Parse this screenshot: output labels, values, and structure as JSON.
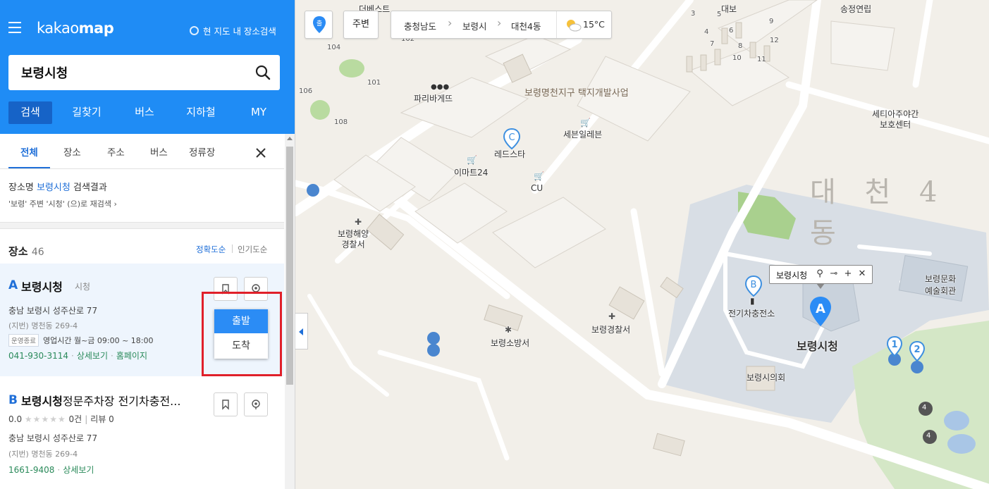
{
  "header": {
    "logo_light": "kakao",
    "logo_bold": "map",
    "area_search_label": "현 지도 내 장소검색",
    "search_value": "보령시청",
    "main_tabs": [
      {
        "label": "검색",
        "active": true
      },
      {
        "label": "길찾기",
        "active": false
      },
      {
        "label": "버스",
        "active": false
      },
      {
        "label": "지하철",
        "active": false
      },
      {
        "label": "MY",
        "active": false
      }
    ]
  },
  "sub_tabs": [
    {
      "label": "전체",
      "active": true
    },
    {
      "label": "장소",
      "active": false
    },
    {
      "label": "주소",
      "active": false
    },
    {
      "label": "버스",
      "active": false
    },
    {
      "label": "정류장",
      "active": false
    }
  ],
  "result": {
    "prefix": "장소명 ",
    "query": "보령시청",
    "suffix": " 검색결과",
    "research_text": "'보령' 주변 '시청' (으)로 재검색 ›"
  },
  "places": {
    "heading": "장소",
    "count": "46",
    "sort_accuracy": "정확도순",
    "sort_popularity": "인기도순"
  },
  "items": [
    {
      "marker": "A",
      "title_bold": "보령시청",
      "title_rest": "",
      "category": "시청",
      "address": "충남 보령시 성주산로 77",
      "lot_address": "(지번) 명천동 269-4",
      "hours_tag": "운영종료",
      "hours": "영업시간 월~금 09:00 ~ 18:00",
      "phone": "041-930-3114",
      "detail_link": "상세보기",
      "homepage_link": "홈페이지"
    },
    {
      "marker": "B",
      "title_bold": "보령시청",
      "title_rest": "정문주차장 전기차충전...",
      "rating": "0.0",
      "stars": "★★★★★",
      "rating_count": "0건",
      "review": "리뷰 0",
      "address": "충남 보령시 성주산로 77",
      "lot_address": "(지번) 명천동 269-4",
      "phone": "1661-9408",
      "detail_link": "상세보기"
    }
  ],
  "route_popup": {
    "departure": "출발",
    "arrival": "도착"
  },
  "map": {
    "my_location_label": "출",
    "nearby_label": "주변",
    "breadcrumb": [
      "충청남도",
      "보령시",
      "대천4동"
    ],
    "weather": "15°C",
    "dong_label": "대 천 4 동",
    "redevelopment_label": "보령명천지구 택지개발사업",
    "labels": {
      "paris": "파리바게뜨",
      "seven": "세븐일레븐",
      "redstar": "레드스타",
      "emart": "이마트24",
      "cu": "CU",
      "police_sea": "보령해양\n경찰서",
      "police": "보령경찰서",
      "fire": "보령소방서",
      "ev": "전기차충전소",
      "cityhall": "보령시청",
      "council": "보령시의회",
      "culture": "보령문화\n예술회관",
      "elder": "세티아주야간\n보호센터",
      "songjeong": "송정연립",
      "daebo": "대보",
      "debest": "더베스트"
    },
    "tooltip_title": "보령시청",
    "pin_a": "A",
    "pin_b": "B",
    "pin_c": "C",
    "pin_1": "1",
    "pin_2": "2",
    "park_num_1": "4",
    "park_num_2": "4",
    "building_numbers": [
      "101",
      "102",
      "104",
      "106",
      "108",
      "3",
      "4",
      "5",
      "6",
      "7",
      "8",
      "9",
      "10",
      "11",
      "12"
    ]
  },
  "colors": {
    "header_blue": "#1f8cf5",
    "active_tab": "#1663c7",
    "link_blue": "#1f6fd8",
    "highlight_red": "#e0202a",
    "phone_green": "#2a8a5a"
  }
}
